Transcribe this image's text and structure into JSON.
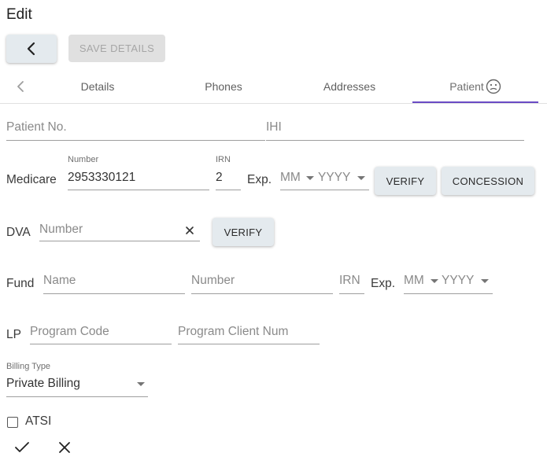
{
  "header": {
    "title": "Edit"
  },
  "toolbar": {
    "back_icon": "chevron-left-icon",
    "save_label": "SAVE DETAILS"
  },
  "tabs": {
    "prev_icon": "chevron-left-icon",
    "items": [
      {
        "label": "Details"
      },
      {
        "label": "Phones"
      },
      {
        "label": "Addresses"
      },
      {
        "label": "Patient",
        "icon": "neutral-face-icon",
        "active": true
      }
    ]
  },
  "patient": {
    "patient_no_placeholder": "Patient No.",
    "ihi_placeholder": "IHI"
  },
  "medicare": {
    "label": "Medicare",
    "number_label": "Number",
    "number_value": "2953330121",
    "irn_label": "IRN",
    "irn_value": "2",
    "exp_label": "Exp.",
    "month_placeholder": "MM",
    "year_placeholder": "YYYY",
    "verify_label": "VERIFY",
    "concession_label": "CONCESSION"
  },
  "dva": {
    "label": "DVA",
    "number_placeholder": "Number",
    "clear_icon": "close-icon",
    "verify_label": "VERIFY"
  },
  "fund": {
    "label": "Fund",
    "name_placeholder": "Name",
    "number_placeholder": "Number",
    "irn_placeholder": "IRN",
    "exp_label": "Exp.",
    "month_placeholder": "MM",
    "year_placeholder": "YYYY"
  },
  "lp": {
    "label": "LP",
    "program_code_placeholder": "Program Code",
    "program_client_placeholder": "Program Client Num"
  },
  "billing": {
    "label": "Billing Type",
    "value": "Private Billing"
  },
  "atsi": {
    "label": "ATSI",
    "checked": false
  },
  "actions": {
    "confirm_icon": "check-icon",
    "cancel_icon": "close-icon"
  },
  "colors": {
    "accent": "#6a4bc4",
    "button_bg": "#e4eaee",
    "disabled_bg": "#e0e0e0"
  }
}
